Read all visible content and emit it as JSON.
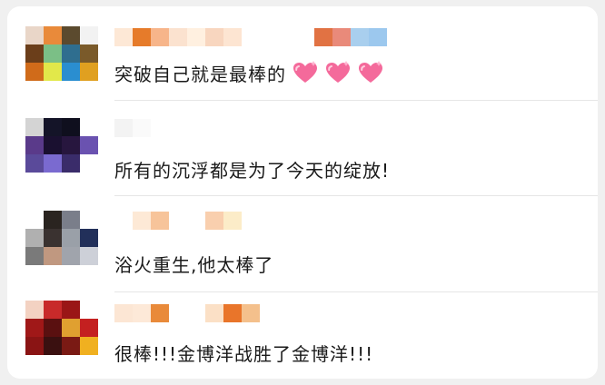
{
  "comments": [
    {
      "text": "突破自己就是最棒的",
      "reactions": [
        "sparkle-heart-icon",
        "sparkle-heart-icon",
        "sparkle-heart-icon"
      ]
    },
    {
      "text": "所有的沉浮都是为了今天的绽放!"
    },
    {
      "text": "浴火重生,他太棒了"
    },
    {
      "text": "很棒!!!金博洋战胜了金博洋!!!"
    }
  ],
  "colors": {
    "heart_pink": "#f46a9b",
    "heart_light": "#ffb3cf",
    "divider": "#e6e6e6",
    "text": "#1a1a1a"
  }
}
